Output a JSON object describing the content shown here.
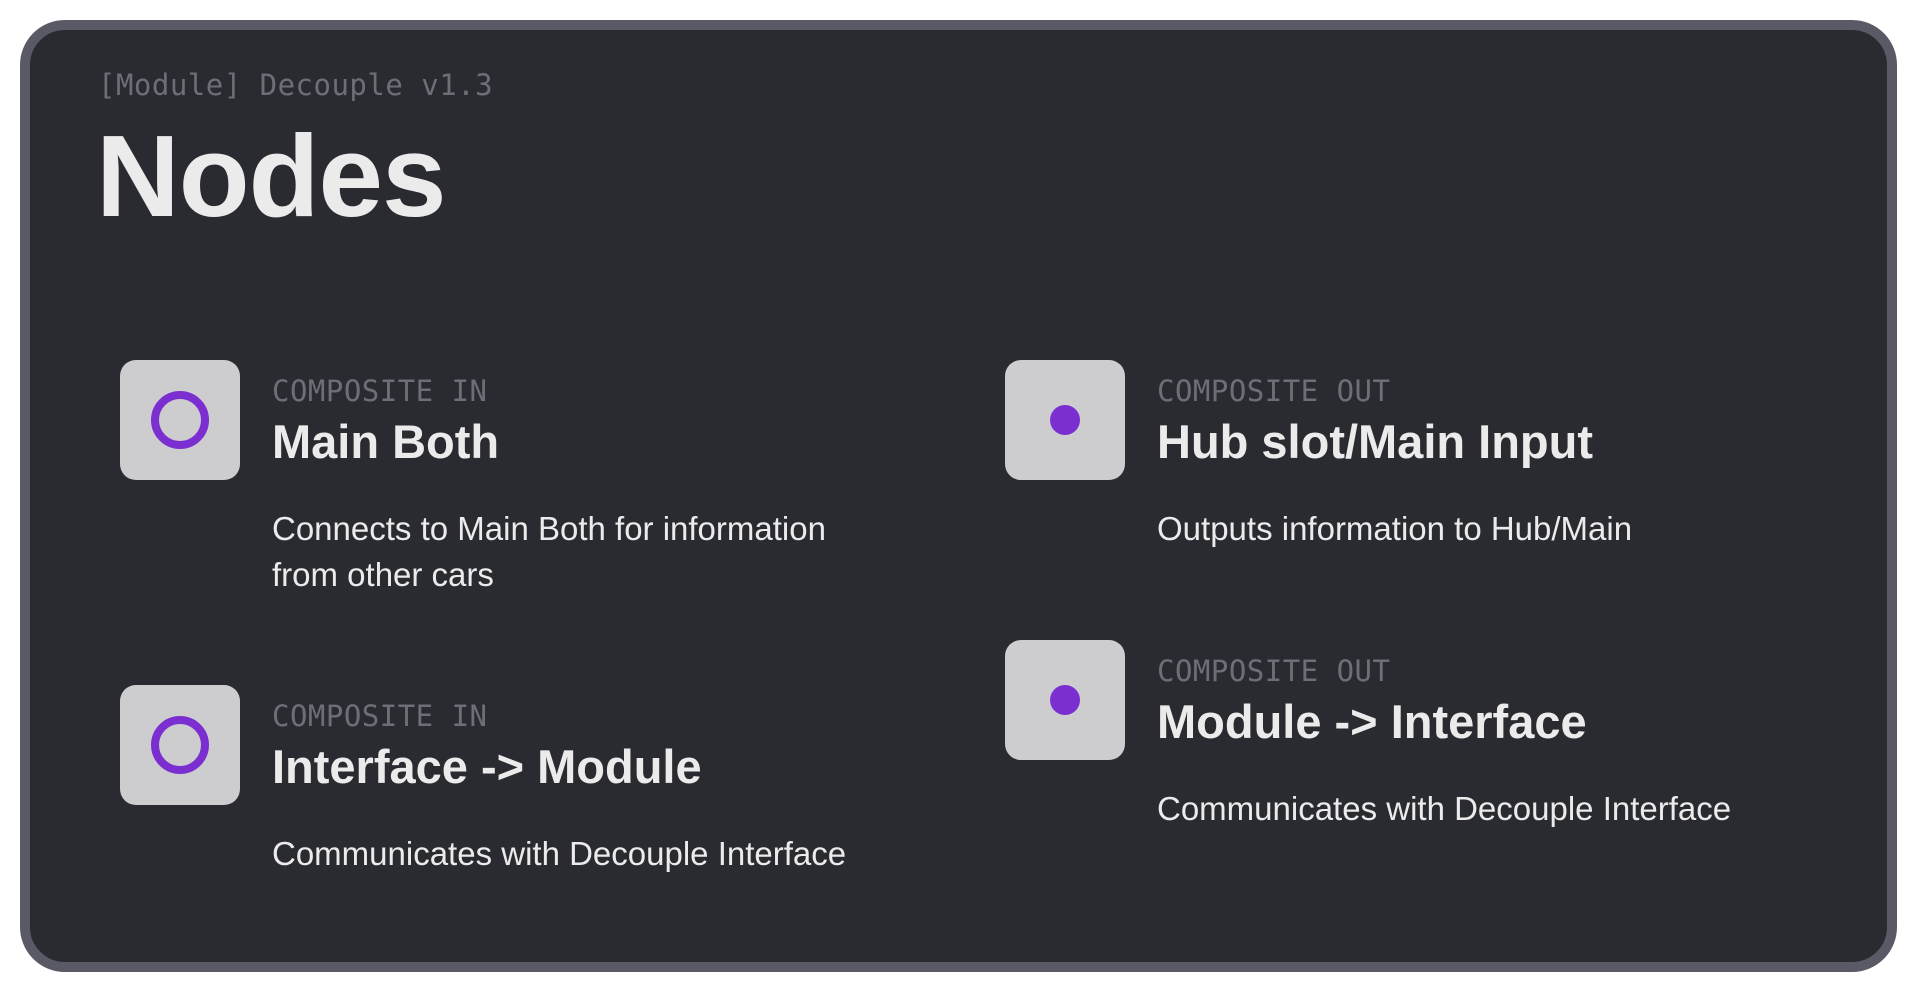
{
  "header": {
    "subtitle": "[Module] Decouple v1.3",
    "title": "Nodes"
  },
  "nodes": [
    {
      "kind": "COMPOSITE IN",
      "name": "Main Both",
      "description": "Connects to Main Both for information from other cars",
      "icon": "ring-icon"
    },
    {
      "kind": "COMPOSITE OUT",
      "name": "Hub slot/Main Input",
      "description": "Outputs information to Hub/Main",
      "icon": "dot-icon"
    },
    {
      "kind": "COMPOSITE IN",
      "name": "Interface -> Module",
      "description": "Communicates with Decouple Interface",
      "icon": "ring-icon"
    },
    {
      "kind": "COMPOSITE OUT",
      "name": "Module -> Interface",
      "description": "Communicates with Decouple Interface",
      "icon": "dot-icon"
    }
  ],
  "colors": {
    "background": "#2a2b31",
    "border": "#5a5a66",
    "icon_tile": "#cdcdd0",
    "accent": "#7b2fd0",
    "muted_text": "#6e6e79",
    "text": "#ebebeb"
  }
}
